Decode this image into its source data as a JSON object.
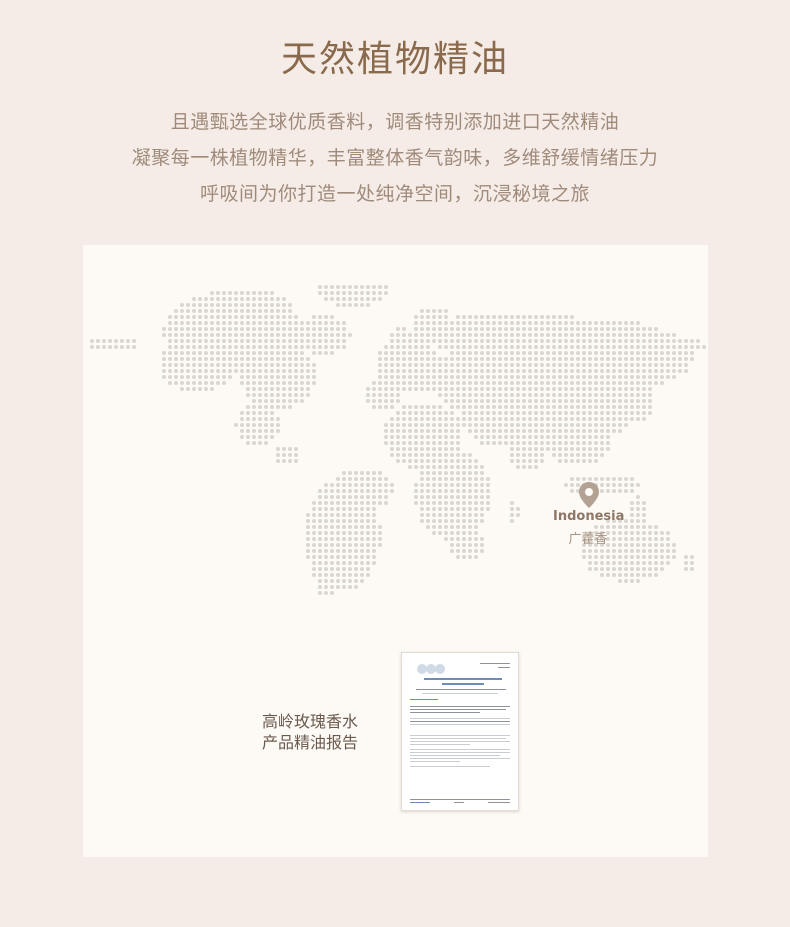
{
  "header": {
    "title": "天然植物精油",
    "lines": [
      "且遇甄选全球优质香料，调香特别添加进口天然精油",
      "凝聚每一株植物精华，丰富整体香气韵味，多维舒缓情绪压力",
      "呼吸间为你打造一处纯净空间，沉浸秘境之旅"
    ]
  },
  "map": {
    "location_name": "Indonesia",
    "location_sub": "广藿香",
    "pin_icon": "location-pin-icon",
    "dot_color": "#dcd6d0",
    "pin_color": "#b3a294"
  },
  "report": {
    "label_line1": "高岭玫瑰香水",
    "label_line2": "产品精油报告"
  },
  "colors": {
    "background": "#f5ece7",
    "panel": "#fdfaf6",
    "title": "#8a6a4c",
    "text": "#a08b7b"
  }
}
